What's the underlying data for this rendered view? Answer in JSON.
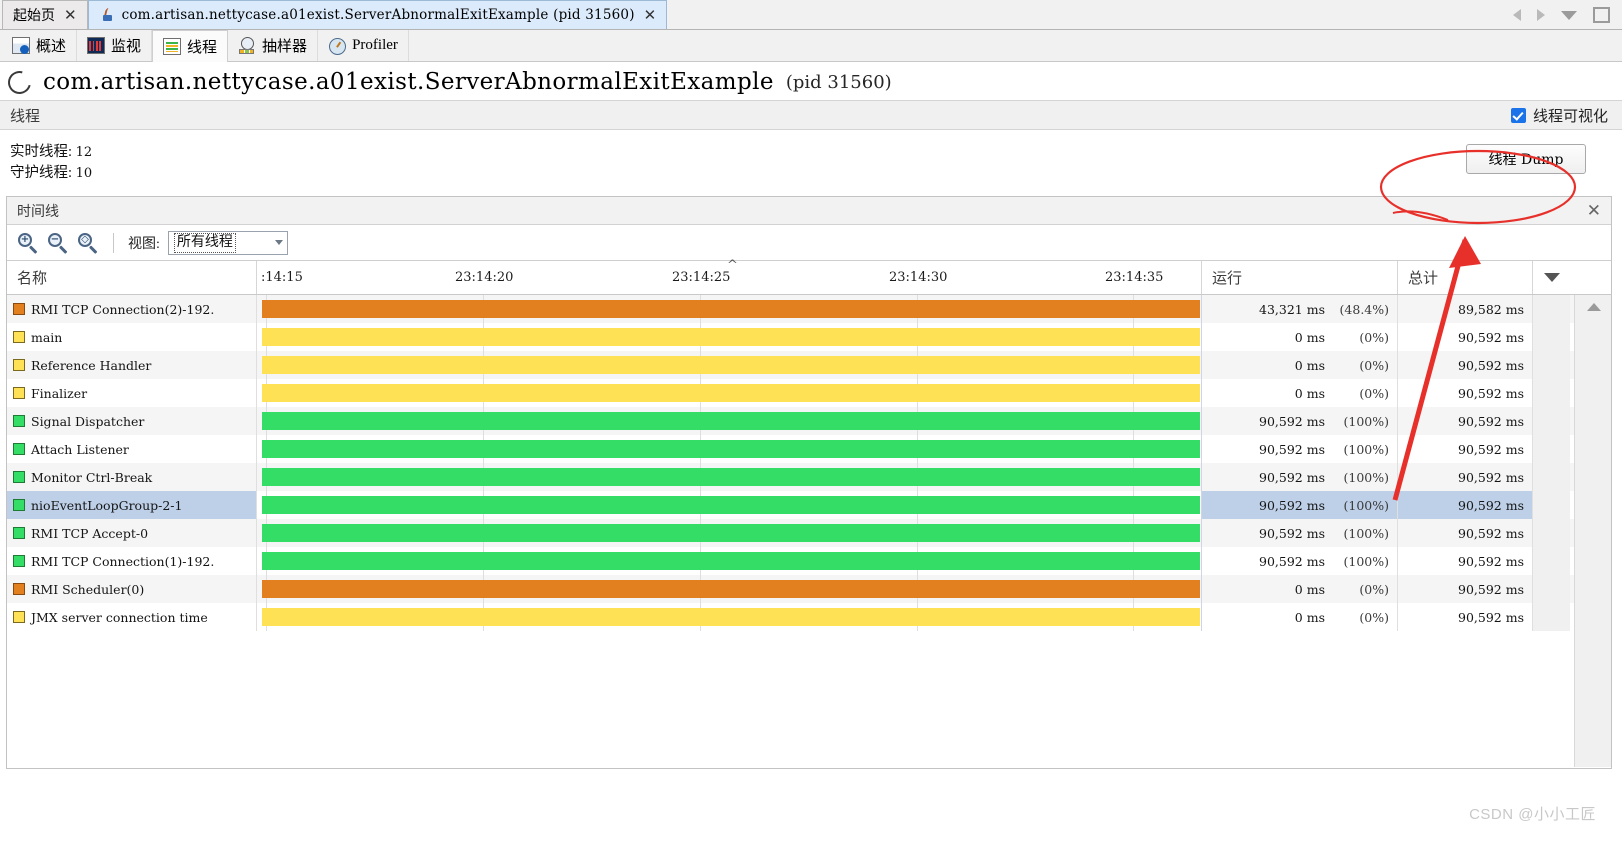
{
  "window": {
    "tabs": [
      {
        "label": "起始页",
        "icon": "none",
        "active": false,
        "closable": true
      },
      {
        "label": "com.artisan.nettycase.a01exist.ServerAbnormalExitExample (pid 31560)",
        "icon": "java-icon",
        "active": true,
        "closable": true
      }
    ],
    "nav": {
      "prev_icon": "chevron-left-icon",
      "next_icon": "chevron-right-icon",
      "list_icon": "chevron-down-icon",
      "maximize_icon": "maximize-icon"
    }
  },
  "viewtabs": [
    {
      "label": "概述",
      "icon": "overview-icon",
      "selected": false
    },
    {
      "label": "监视",
      "icon": "monitor-icon",
      "selected": false
    },
    {
      "label": "线程",
      "icon": "threads-icon",
      "selected": true
    },
    {
      "label": "抽样器",
      "icon": "sampler-icon",
      "selected": false
    },
    {
      "label": "Profiler",
      "icon": "profiler-icon",
      "selected": false
    }
  ],
  "header": {
    "reload_icon": "reload-icon",
    "title": "com.artisan.nettycase.a01exist.ServerAbnormalExitExample",
    "pid": "(pid 31560)"
  },
  "section": {
    "title": "线程",
    "visualize_checkbox_label": "线程可视化",
    "visualize_checked": true
  },
  "counts": {
    "live_label": "实时线程:",
    "live_value": "12",
    "daemon_label": "守护线程:",
    "daemon_value": "10",
    "dump_button": "线程 Dump"
  },
  "timeline": {
    "title": "时间线",
    "close_icon": "close-icon",
    "zoom_in_icon": "zoom-in-icon",
    "zoom_out_icon": "zoom-out-icon",
    "zoom_fit_icon": "zoom-fit-icon",
    "view_label": "视图:",
    "view_value": "所有线程",
    "view_options": [
      "所有线程"
    ],
    "columns": {
      "name": "名称",
      "running": "运行",
      "total": "总计"
    },
    "dropdown_icon": "column-chooser-icon",
    "time_ticks": [
      ":14:15",
      "23:14:20",
      "23:14:25",
      "23:14:30",
      "23:14:35"
    ],
    "marker_icon": "caret-up-marker"
  },
  "colors": {
    "yellow": "#FFE155",
    "orange": "#E2801F",
    "green": "#33DD66",
    "selection": "#BED0E8",
    "accent": "#1A73E8",
    "annotation_red": "#E8302B"
  },
  "threads": [
    {
      "name": "JMX server connection time",
      "color": "yellow",
      "running_ms": "0 ms",
      "running_pct": "(0%)",
      "total_ms": "90,592 ms",
      "selected": false
    },
    {
      "name": "RMI Scheduler(0)",
      "color": "orange",
      "running_ms": "0 ms",
      "running_pct": "(0%)",
      "total_ms": "90,592 ms",
      "selected": false
    },
    {
      "name": "RMI TCP Connection(1)-192.",
      "color": "green",
      "running_ms": "90,592 ms",
      "running_pct": "(100%)",
      "total_ms": "90,592 ms",
      "selected": false
    },
    {
      "name": "RMI TCP Accept-0",
      "color": "green",
      "running_ms": "90,592 ms",
      "running_pct": "(100%)",
      "total_ms": "90,592 ms",
      "selected": false
    },
    {
      "name": "nioEventLoopGroup-2-1",
      "color": "green",
      "running_ms": "90,592 ms",
      "running_pct": "(100%)",
      "total_ms": "90,592 ms",
      "selected": true
    },
    {
      "name": "Monitor Ctrl-Break",
      "color": "green",
      "running_ms": "90,592 ms",
      "running_pct": "(100%)",
      "total_ms": "90,592 ms",
      "selected": false
    },
    {
      "name": "Attach Listener",
      "color": "green",
      "running_ms": "90,592 ms",
      "running_pct": "(100%)",
      "total_ms": "90,592 ms",
      "selected": false
    },
    {
      "name": "Signal Dispatcher",
      "color": "green",
      "running_ms": "90,592 ms",
      "running_pct": "(100%)",
      "total_ms": "90,592 ms",
      "selected": false
    },
    {
      "name": "Finalizer",
      "color": "yellow",
      "running_ms": "0 ms",
      "running_pct": "(0%)",
      "total_ms": "90,592 ms",
      "selected": false
    },
    {
      "name": "Reference Handler",
      "color": "yellow",
      "running_ms": "0 ms",
      "running_pct": "(0%)",
      "total_ms": "90,592 ms",
      "selected": false
    },
    {
      "name": "main",
      "color": "yellow",
      "running_ms": "0 ms",
      "running_pct": "(0%)",
      "total_ms": "90,592 ms",
      "selected": false
    },
    {
      "name": "RMI TCP Connection(2)-192.",
      "color": "orange",
      "running_ms": "43,321 ms",
      "running_pct": "(48.4%)",
      "total_ms": "89,582 ms",
      "selected": false
    }
  ],
  "watermark": "CSDN @小小工匠"
}
